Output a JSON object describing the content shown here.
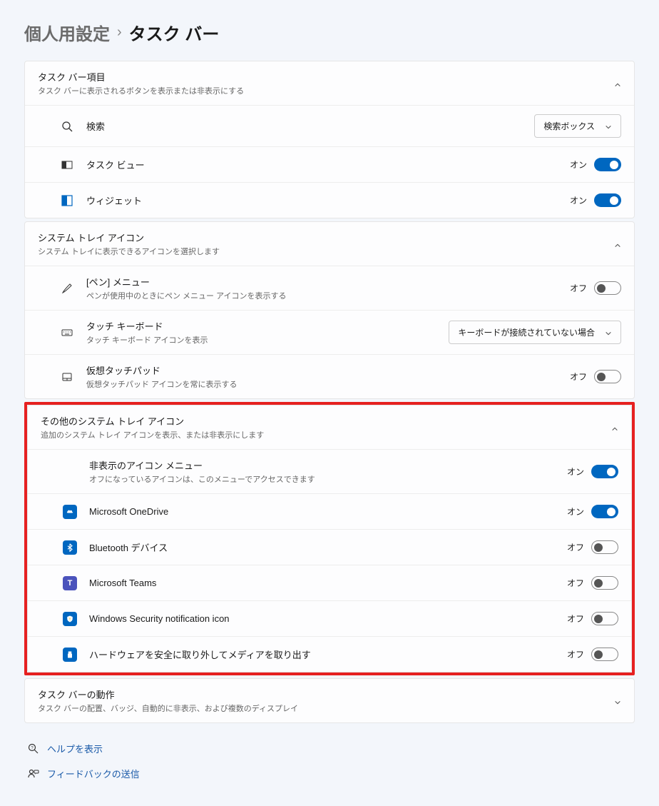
{
  "breadcrumb": {
    "parent": "個人用設定",
    "current": "タスク バー"
  },
  "sections": {
    "taskbar_items": {
      "title": "タスク バー項目",
      "subtitle": "タスク バーに表示されるボタンを表示または非表示にする",
      "rows": {
        "search": {
          "label": "検索",
          "dropdown": "検索ボックス"
        },
        "taskview": {
          "label": "タスク ビュー",
          "state": "オン"
        },
        "widgets": {
          "label": "ウィジェット",
          "state": "オン"
        }
      }
    },
    "system_tray": {
      "title": "システム トレイ アイコン",
      "subtitle": "システム トレイに表示できるアイコンを選択します",
      "rows": {
        "pen": {
          "label": "[ペン] メニュー",
          "sublabel": "ペンが使用中のときにペン メニュー アイコンを表示する",
          "state": "オフ"
        },
        "touch_keyboard": {
          "label": "タッチ キーボード",
          "sublabel": "タッチ キーボード アイコンを表示",
          "dropdown": "キーボードが接続されていない場合"
        },
        "virtual_touchpad": {
          "label": "仮想タッチパッド",
          "sublabel": "仮想タッチパッド アイコンを常に表示する",
          "state": "オフ"
        }
      }
    },
    "other_tray": {
      "title": "その他のシステム トレイ アイコン",
      "subtitle": "追加のシステム トレイ アイコンを表示、または非表示にします",
      "rows": {
        "hidden_menu": {
          "label": "非表示のアイコン メニュー",
          "sublabel": "オフになっているアイコンは、このメニューでアクセスできます",
          "state": "オン"
        },
        "onedrive": {
          "label": "Microsoft OneDrive",
          "state": "オン"
        },
        "bluetooth": {
          "label": "Bluetooth デバイス",
          "state": "オフ"
        },
        "teams": {
          "label": "Microsoft Teams",
          "state": "オフ"
        },
        "security": {
          "label": "Windows Security notification icon",
          "state": "オフ"
        },
        "safely_remove": {
          "label": "ハードウェアを安全に取り外してメディアを取り出す",
          "state": "オフ"
        }
      }
    },
    "taskbar_behavior": {
      "title": "タスク バーの動作",
      "subtitle": "タスク バーの配置、バッジ、自動的に非表示、および複数のディスプレイ"
    }
  },
  "footer": {
    "help": "ヘルプを表示",
    "feedback": "フィードバックの送信"
  }
}
